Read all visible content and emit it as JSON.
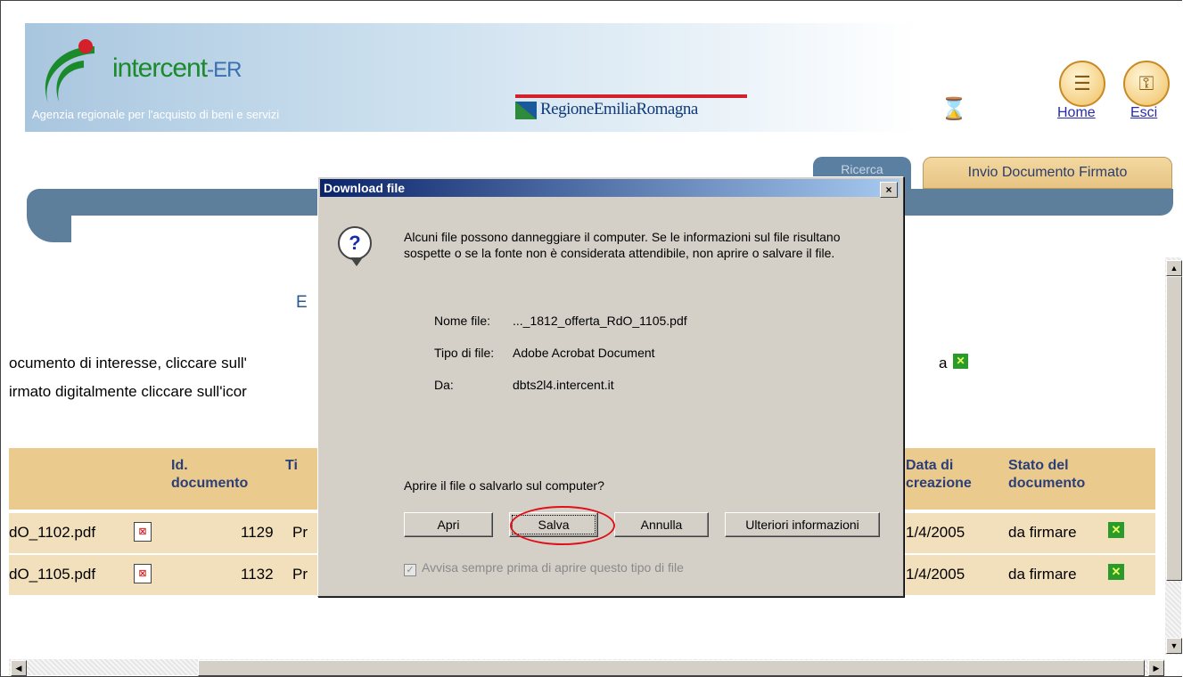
{
  "header": {
    "logo_main": "intercent",
    "logo_suffix": "-ER",
    "agency": "Agenzia regionale per l'acquisto di beni e servizi",
    "regione": "RegioneEmiliaRomagna",
    "home_label": "Home",
    "esci_label": "Esci"
  },
  "tabs": {
    "ricerca": "Ricerca",
    "invio": "Invio Documento Firmato"
  },
  "page": {
    "heading_fragment": "E",
    "line1_left": "ocumento di interesse, cliccare sull'",
    "line1_right": "a",
    "line2_left": "irmato digitalmente cliccare sull'icor"
  },
  "table": {
    "headers": {
      "id": "Id.\ndocumento",
      "tipo": "Ti",
      "data": "Data di\ncreazione",
      "stato": "Stato del\ndocumento"
    },
    "rows": [
      {
        "file": "dO_1102.pdf",
        "id": "1129",
        "tipo": "Pr",
        "data": "1/4/2005",
        "stato": "da firmare"
      },
      {
        "file": "dO_1105.pdf",
        "id": "1132",
        "tipo": "Pr",
        "data": "1/4/2005",
        "stato": "da firmare"
      }
    ]
  },
  "dialog": {
    "title": "Download file",
    "close": "×",
    "message": "Alcuni file possono danneggiare il computer. Se le informazioni sul file risultano sospette o se la fonte non è considerata attendibile, non aprire o salvare il file.",
    "nome_label": "Nome file:",
    "nome_value": "..._1812_offerta_RdO_1105.pdf",
    "tipo_label": "Tipo di file:",
    "tipo_value": "Adobe Acrobat Document",
    "da_label": "Da:",
    "da_value": "dbts2l4.intercent.it",
    "question": "Aprire il file o salvarlo sul computer?",
    "btn_apri": "Apri",
    "btn_salva": "Salva",
    "btn_annulla": "Annulla",
    "btn_info": "Ulteriori informazioni",
    "checkbox_label": "Avvisa sempre prima di aprire questo tipo di file",
    "checkbox_checked": true
  },
  "colors": {
    "accent_tab": "#e7c483",
    "table_header": "#ebca8d",
    "row": "#f2e0bd",
    "dialog_title": "#0a246a",
    "highlight": "#e0101a"
  }
}
